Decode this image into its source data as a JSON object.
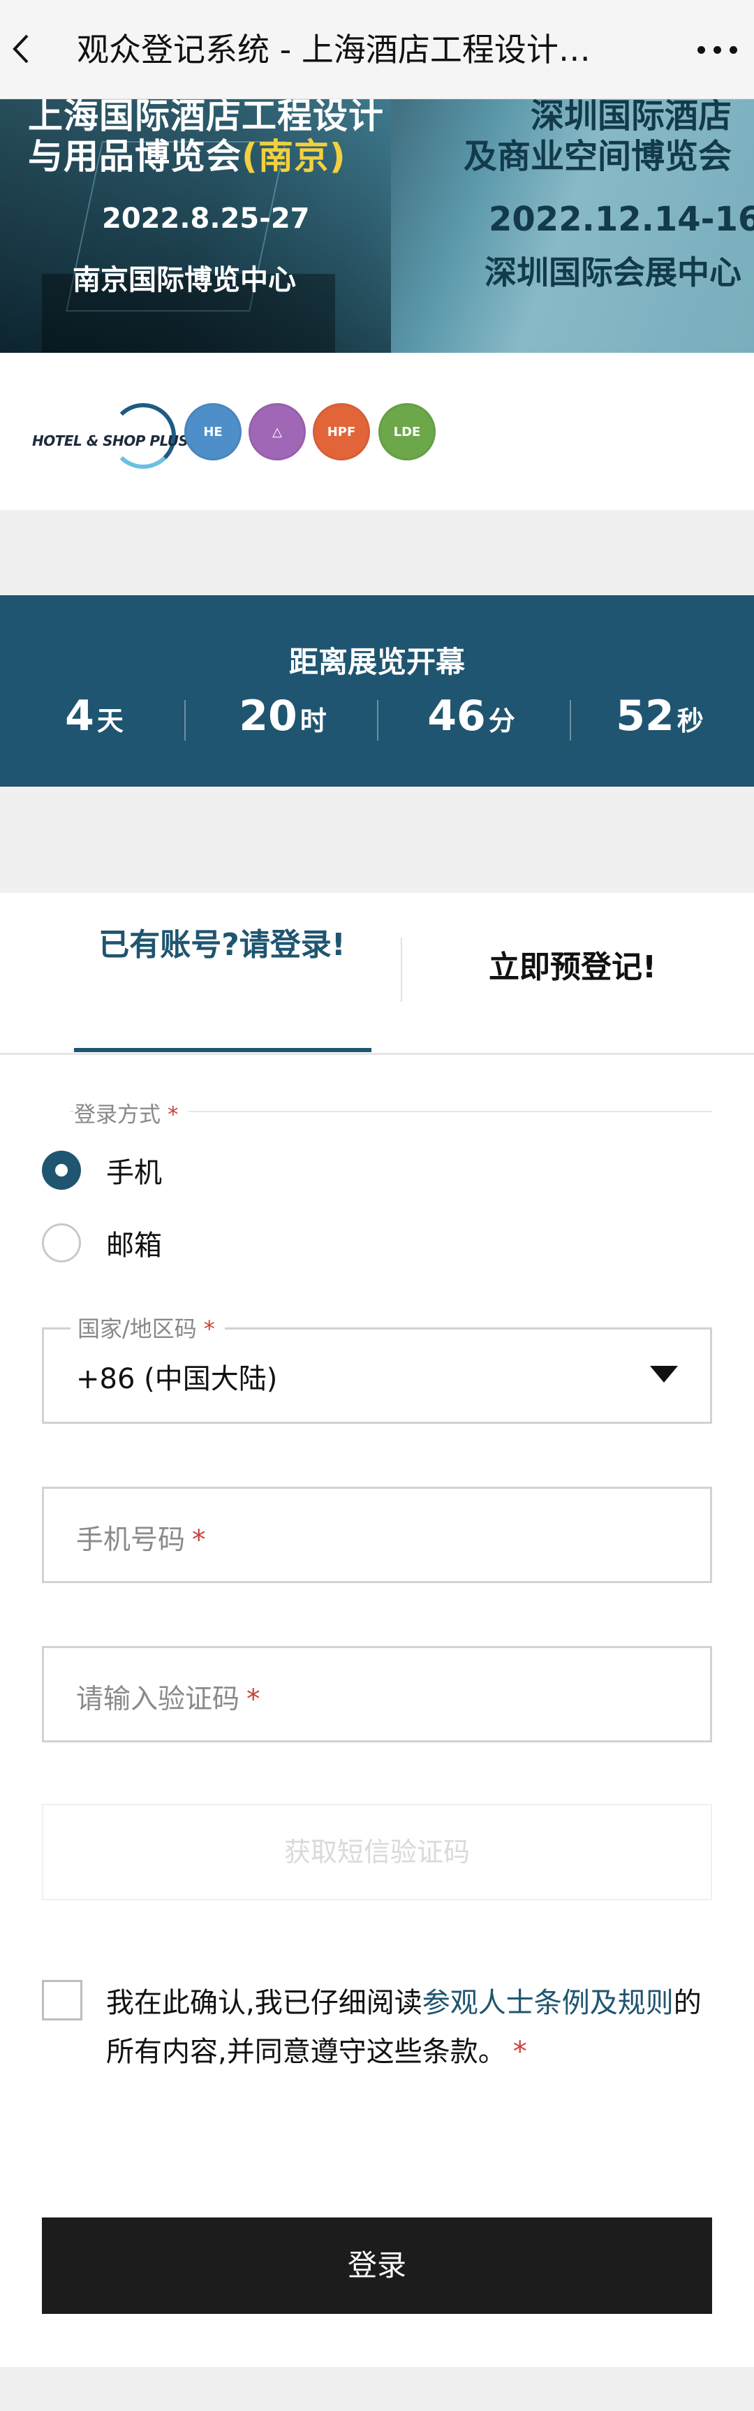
{
  "navbar": {
    "title": "观众登记系统 - 上海酒店工程设计…"
  },
  "banner": {
    "left_line1": "上海国际酒店工程设计",
    "left_line2a": "与用品博览会",
    "left_line2b": "(南京)",
    "left_date": "2022.8.25-27",
    "left_venue": "南京国际博览中心",
    "right_line1": "深圳国际酒店",
    "right_line2": "及商业空间博览会",
    "right_date": "2022.12.14-16",
    "right_venue": "深圳国际会展中心"
  },
  "logos": {
    "hotel_shop": "HOTEL & SHOP PLUS",
    "items": [
      {
        "label": "HE",
        "color": "#4e8fc9"
      },
      {
        "label": "△",
        "color": "#a067b6"
      },
      {
        "label": "HPF",
        "color": "#e2653a"
      },
      {
        "label": "LDE",
        "color": "#6ca84a"
      }
    ]
  },
  "countdown": {
    "title": "距离展览开幕",
    "items": [
      {
        "value": "4",
        "unit": "天"
      },
      {
        "value": "20",
        "unit": "时"
      },
      {
        "value": "46",
        "unit": "分"
      },
      {
        "value": "52",
        "unit": "秒"
      }
    ]
  },
  "tabs": {
    "login": "已有账号?请登录!",
    "register": "立即预登记!"
  },
  "form": {
    "login_method_label": "登录方式",
    "required_mark": "*",
    "methods": [
      "手机",
      "邮箱"
    ],
    "selected_method": "手机",
    "country_label": "国家/地区码",
    "country_value": "+86 (中国大陆)",
    "phone_placeholder": "手机号码",
    "code_placeholder": "请输入验证码",
    "sms_button": "获取短信验证码",
    "agree_prefix": "我在此确认,我已仔细阅读",
    "agree_link": "参观人士条例及规则",
    "agree_suffix": "的所有内容,并同意遵守这些条款。",
    "login_button": "登录"
  }
}
